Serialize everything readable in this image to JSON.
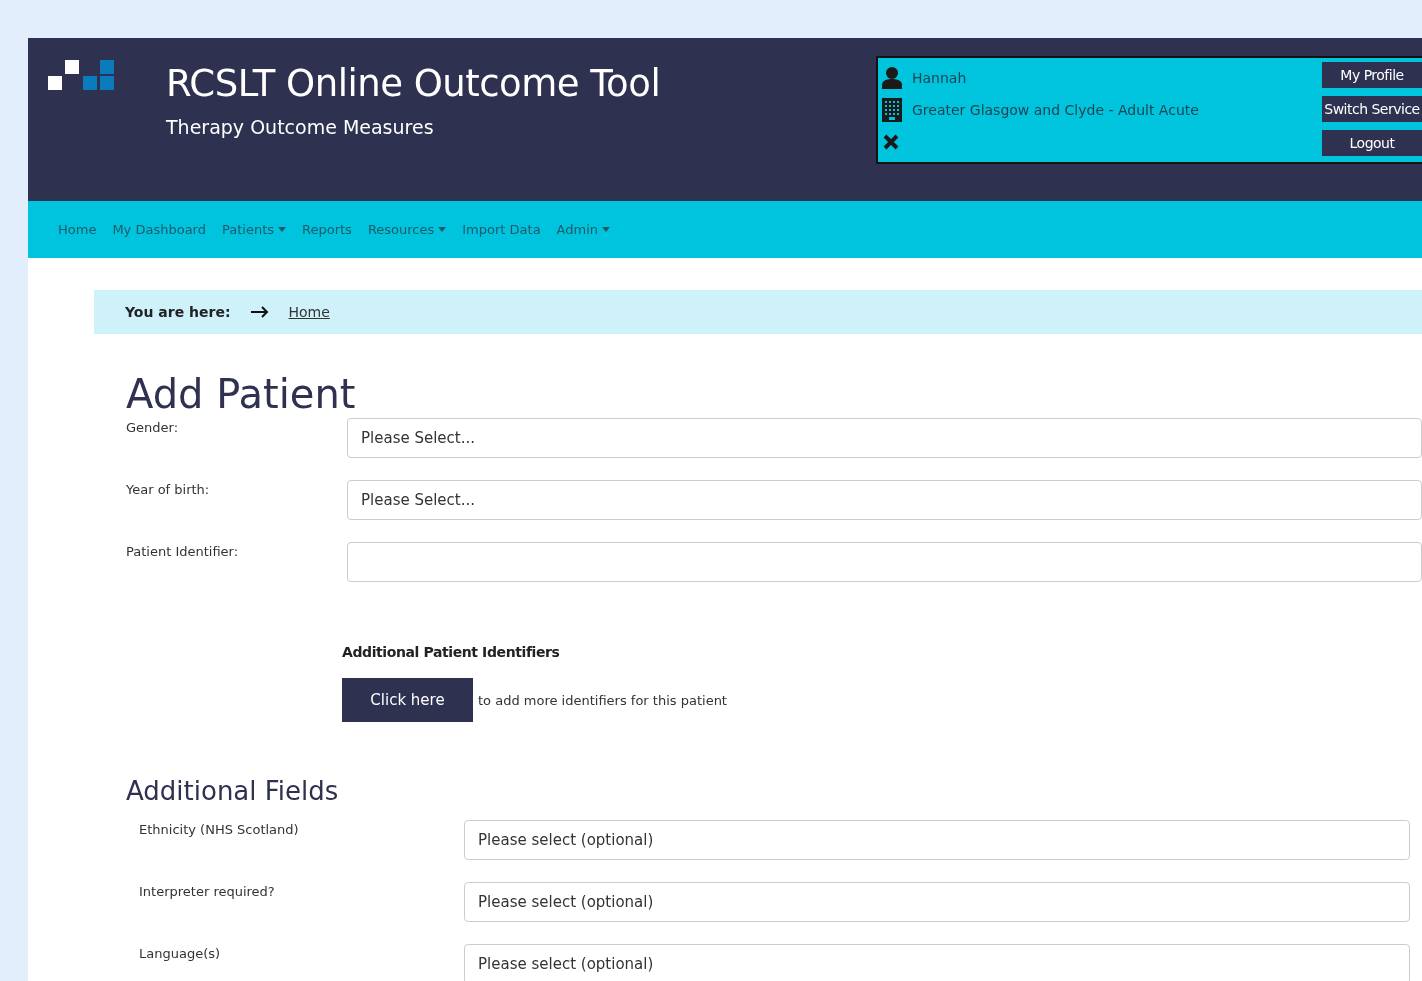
{
  "header": {
    "title": "RCSLT Online Outcome Tool",
    "subtitle": "Therapy Outcome Measures"
  },
  "user_panel": {
    "user": "Hannah",
    "service": "Greater Glasgow and Clyde - Adult Acute",
    "buttons": [
      "My Profile",
      "Switch Service",
      "Logout"
    ]
  },
  "nav": [
    {
      "label": "Home",
      "dropdown": false
    },
    {
      "label": "My Dashboard",
      "dropdown": false
    },
    {
      "label": "Patients",
      "dropdown": true
    },
    {
      "label": "Reports",
      "dropdown": false
    },
    {
      "label": "Resources",
      "dropdown": true
    },
    {
      "label": "Import Data",
      "dropdown": false
    },
    {
      "label": "Admin",
      "dropdown": true
    }
  ],
  "breadcrumb": {
    "label": "You are here:",
    "links": [
      "Home"
    ]
  },
  "title": "Add Patient",
  "fields": [
    {
      "label": "Gender:",
      "kind": "select",
      "value": "Please Select..."
    },
    {
      "label": "Year of birth:",
      "kind": "select",
      "value": "Please Select..."
    },
    {
      "label": "Patient Identifier:",
      "kind": "text"
    }
  ],
  "identifiers": {
    "heading": "Additional Patient Identifiers",
    "button": "Click here",
    "text": "to add more identifiers for this patient"
  },
  "additional": {
    "heading": "Additional Fields",
    "fields": [
      {
        "label": "Ethnicity (NHS Scotland)",
        "value": "Please select (optional)"
      },
      {
        "label": "Interpreter required?",
        "value": "Please select (optional)"
      },
      {
        "label": "Language(s)",
        "value": "Please select (optional)"
      }
    ]
  }
}
